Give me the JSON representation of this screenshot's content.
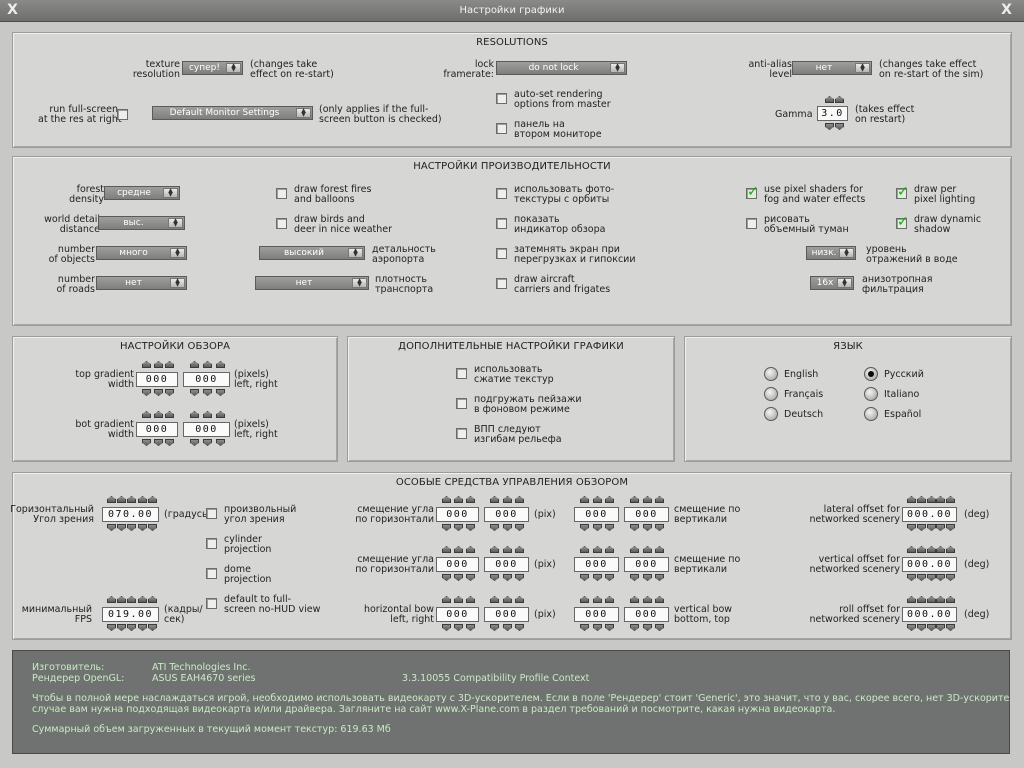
{
  "window": {
    "title": "Настройки графики",
    "close_left": "X",
    "close_right": "X"
  },
  "resolutions": {
    "title": "RESOLUTIONS",
    "texture_label": "texture\nresolution",
    "texture_value": "супер!",
    "texture_note": "(changes take\neffect on re-start)",
    "lock_label": "lock\nframerate:",
    "lock_value": "do not lock",
    "antialias_label": "anti-alias\nlevel",
    "antialias_value": "нет",
    "antialias_note": "(changes take effect\non re-start of the sim)",
    "fullscreen_label": "run full-screen\nat the res at right",
    "monitor_value": "Default Monitor Settings",
    "monitor_note": "(only applies if the full-\nscreen button is checked)",
    "auto_set": "auto-set rendering\noptions from master",
    "second_monitor": "панель на\nвтором мониторе",
    "gamma_label": "Gamma",
    "gamma_value": "3.0",
    "gamma_note": "(takes effect\non restart)"
  },
  "performance": {
    "title": "НАСТРОЙКИ ПРОИЗВОДИТЕЛЬНОСТИ",
    "forest_label": "forest\ndensity",
    "forest_value": "средне",
    "world_label": "world detail\ndistance",
    "world_value": "выс.",
    "objects_label": "number\nof objects",
    "objects_value": "много",
    "roads_label": "number\nof roads",
    "roads_value": "нет",
    "airport_value": "высокий",
    "airport_label": "детальность\nаэропорта",
    "traffic_value": "нет",
    "traffic_label": "плотность\nтранспорта",
    "fires": "draw forest fires\nand balloons",
    "birds": "draw birds and\ndeer in nice weather",
    "photo": "использовать фото-\nтекстуры с орбиты",
    "indicator": "показать\nиндикатор обзора",
    "blackout": "затемнять экран при\nперегрузках и гипоксии",
    "carriers": "draw aircraft\ncarriers and frigates",
    "pixel_shaders": "use pixel shaders for\nfog and water effects",
    "volumetric_fog": "рисовать\nобъемный туман",
    "per_pixel": "draw per\npixel lighting",
    "dyn_shadow": "draw dynamic\nshadow",
    "water_value": "низк.",
    "water_label": "уровень\nотражений в воде",
    "aniso_value": "16x",
    "aniso_label": "анизотропная\nфильтрация"
  },
  "view": {
    "title": "НАСТРОЙКИ ОБЗОРА",
    "top_label": "top gradient\nwidth",
    "top_left": "000",
    "top_right": "000",
    "top_note": "(pixels)\nleft, right",
    "bot_label": "bot gradient\nwidth",
    "bot_left": "000",
    "bot_right": "000",
    "bot_note": "(pixels)\nleft, right"
  },
  "extra": {
    "title": "ДОПОЛНИТЕЛЬНЫЕ НАСТРОЙКИ ГРАФИКИ",
    "compress": "использовать\nсжатие текстур",
    "bg_load": "подгружать пейзажи\nв фоновом режиме",
    "vpp": "ВПП следуют\nизгибам рельефа"
  },
  "language": {
    "title": "ЯЗЫК",
    "en": "English",
    "ru": "Русский",
    "fr": "Français",
    "it": "Italiano",
    "de": "Deutsch",
    "es": "Español"
  },
  "special": {
    "title": "ОСОБЫЕ СРЕДСТВА УПРАВЛЕНИЯ ОБЗОРОМ",
    "fov_label": "Горизонтальный\nУгол зрения",
    "fov_value": "070.00",
    "fov_unit": "(градусы)",
    "fps_label": "минимальный\nFPS",
    "fps_value": "019.00",
    "fps_unit": "(кадры/\nсек)",
    "arb_angle": "произвольный\nугол зрения",
    "cylinder": "cylinder\nprojection",
    "dome": "dome\nprojection",
    "nohud": "default to full-\nscreen no-HUD view",
    "hshift1_label": "смещение угла\nпо горизонтали",
    "hshift2_label": "смещение угла\nпо горизонтали",
    "hbow_label": "horizontal bow\nleft, right",
    "v000": "000",
    "pix": "(pix)",
    "vshift1_label": "смещение по\nвертикали",
    "vshift2_label": "смещение по\nвертикали",
    "vbow_label": "vertical bow\nbottom, top",
    "lateral_label": "lateral offset for\nnetworked scenery",
    "vertical_label": "vertical offset for\nnetworked scenery",
    "roll_label": "roll offset for\nnetworked scenery",
    "v00000": "000.00",
    "deg": "(deg)"
  },
  "info": {
    "vendor_label": "Изготовитель:",
    "vendor_value": "ATI Technologies Inc.",
    "renderer_label": "Рендерер OpenGL:",
    "renderer_value": "ASUS EAH4670 series",
    "version": "3.3.10055 Compatibility Profile Context",
    "line1": "Чтобы в полной мере наслаждаться игрой, необходимо использовать видеокарту с 3D-ускорителем. Если в поле 'Рендерер' стоит 'Generic', это значит, что у вас, скорее всего, нет 3D-ускорителя. В этом",
    "line2": "случае вам нужна подходящая видеокарта и/или драйвера. Загляните на сайт www.X-Plane.com в раздел требований и посмотрите, какая нужна видеокарта.",
    "memory": "Суммарный объем загруженных в текущий момент текстур: 619.63 Мб"
  },
  "colors": {
    "info_text": "#c9ecc4",
    "check": "#16a816",
    "panel": "#d6d6d4"
  }
}
